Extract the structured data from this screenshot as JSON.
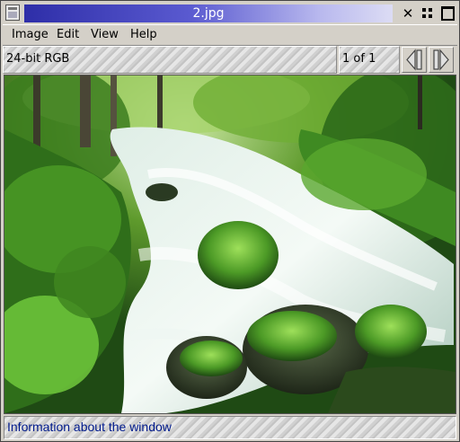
{
  "window": {
    "title": "2.jpg"
  },
  "menu": {
    "items": [
      {
        "label": "Image"
      },
      {
        "label": "Edit"
      },
      {
        "label": "View"
      },
      {
        "label": "Help"
      }
    ]
  },
  "info": {
    "format": "24-bit RGB",
    "page": "1 of 1"
  },
  "status": {
    "text": "Information about the window"
  },
  "colors": {
    "title_gradient_start": "#2e2ea8",
    "status_text": "#001a8c"
  },
  "icons": [
    "app-icon",
    "close-icon",
    "iconify-icon",
    "maximize-icon",
    "prev-page-icon",
    "next-page-icon"
  ]
}
